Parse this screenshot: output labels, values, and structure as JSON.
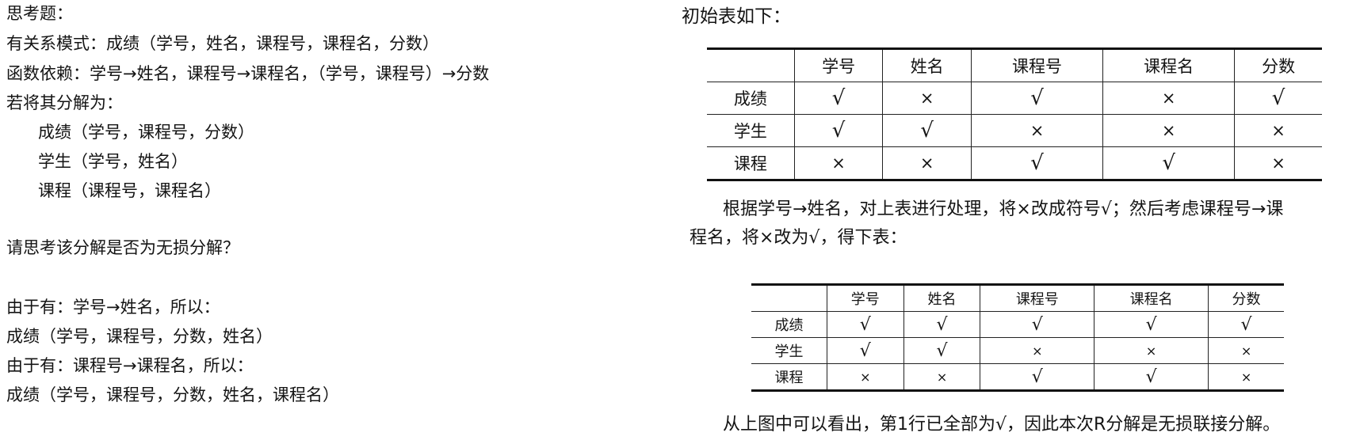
{
  "left": {
    "title": "思考题：",
    "schema": "有关系模式：成绩（学号，姓名，课程号，课程名，分数）",
    "fds": "函数依赖：学号→姓名，课程号→课程名，（学号，课程号）→分数",
    "decompose_intro": "若将其分解为：",
    "decomp": [
      "成绩（学号，课程号，分数）",
      "学生（学号，姓名）",
      "课程（课程号，课程名）"
    ],
    "question": "请思考该分解是否为无损分解？",
    "step1": "由于有：学号→姓名，所以：",
    "step1_result": "成绩（学号，课程号，分数，姓名）",
    "step2": "由于有：课程号→课程名，所以：",
    "step2_result": "成绩（学号，课程号，分数，姓名，课程名）"
  },
  "right": {
    "intro": "初始表如下：",
    "table_headers": [
      "",
      "学号",
      "姓名",
      "课程号",
      "课程名",
      "分数"
    ],
    "table1": [
      [
        "成绩",
        "√",
        "×",
        "√",
        "×",
        "√"
      ],
      [
        "学生",
        "√",
        "√",
        "×",
        "×",
        "×"
      ],
      [
        "课程",
        "×",
        "×",
        "√",
        "√",
        "×"
      ]
    ],
    "explain_line1": "根据学号→姓名，对上表进行处理，将×改成符号√；然后考虑课程号→课",
    "explain_line2": "程名，将×改为√，得下表：",
    "table2": [
      [
        "成绩",
        "√",
        "√",
        "√",
        "√",
        "√"
      ],
      [
        "学生",
        "√",
        "√",
        "×",
        "×",
        "×"
      ],
      [
        "课程",
        "×",
        "×",
        "√",
        "√",
        "×"
      ]
    ],
    "conclusion": "从上图中可以看出，第1行已全部为√，因此本次R分解是无损联接分解。"
  }
}
